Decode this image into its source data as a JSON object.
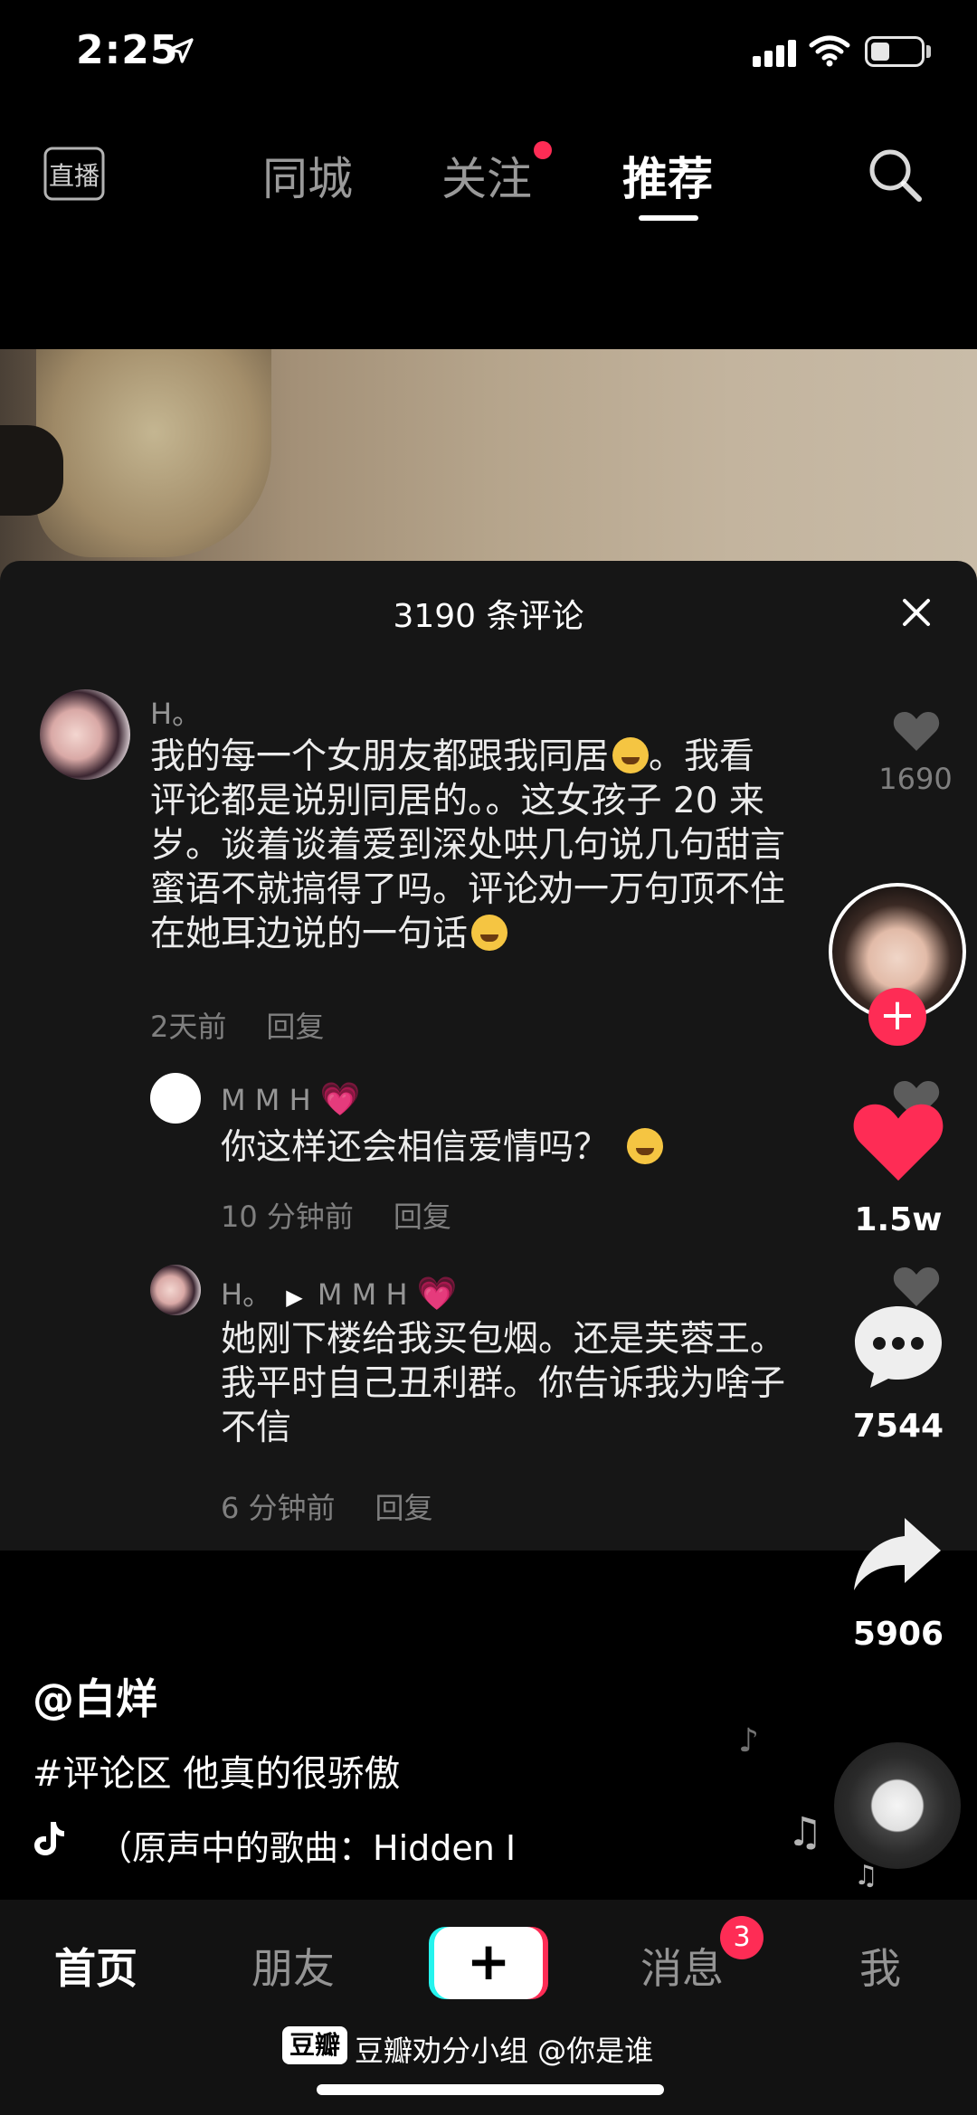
{
  "status_bar": {
    "time": "2:25"
  },
  "top_nav": {
    "live_icon_label": "直播",
    "tabs": [
      {
        "label": "同城"
      },
      {
        "label": "关注"
      },
      {
        "label": "推荐"
      }
    ]
  },
  "comments_panel": {
    "title": "3190 条评论",
    "comments": [
      {
        "user": "H。",
        "text_lines": [
          "我的每一个女朋友都跟我同居",
          "。我看",
          "评论都是说别同居的。。这女孩子 20 来",
          "岁。谈着谈着爱到深处哄几句说几句甜言",
          "蜜语不就搞得了吗。评论劝一万句顶不住",
          "在她耳边说的一句话"
        ],
        "time": "2天前",
        "reply": "回复",
        "likes": "1690"
      },
      {
        "user": "M M H",
        "text": "你这样还会相信爱情吗？",
        "time": "10 分钟前",
        "reply": "回复"
      },
      {
        "user": "H。",
        "reply_to": "M M H",
        "text_lines": [
          "她刚下楼给我买包烟。还是芙蓉王。",
          "我平时自己丑利群。你告诉我为啥子",
          "不信"
        ],
        "time": "6 分钟前",
        "reply": "回复"
      }
    ]
  },
  "actions": {
    "likes": "1.5w",
    "comments": "7544",
    "shares": "5906"
  },
  "video_info": {
    "author": "@白烊",
    "caption": "#评论区 他真的很骄傲",
    "music": "（原声中的歌曲：Hidden I"
  },
  "bottom_tabs": {
    "home": "首页",
    "friends": "朋友",
    "create": "+",
    "messages": "消息",
    "messages_badge": "3",
    "me": "我"
  },
  "watermark": {
    "logo": "豆瓣",
    "text": "豆瓣劝分小组 @你是谁"
  },
  "colors": {
    "accent": "#fe2c55",
    "cyan": "#25f4ee",
    "panel_bg": "#161616"
  }
}
